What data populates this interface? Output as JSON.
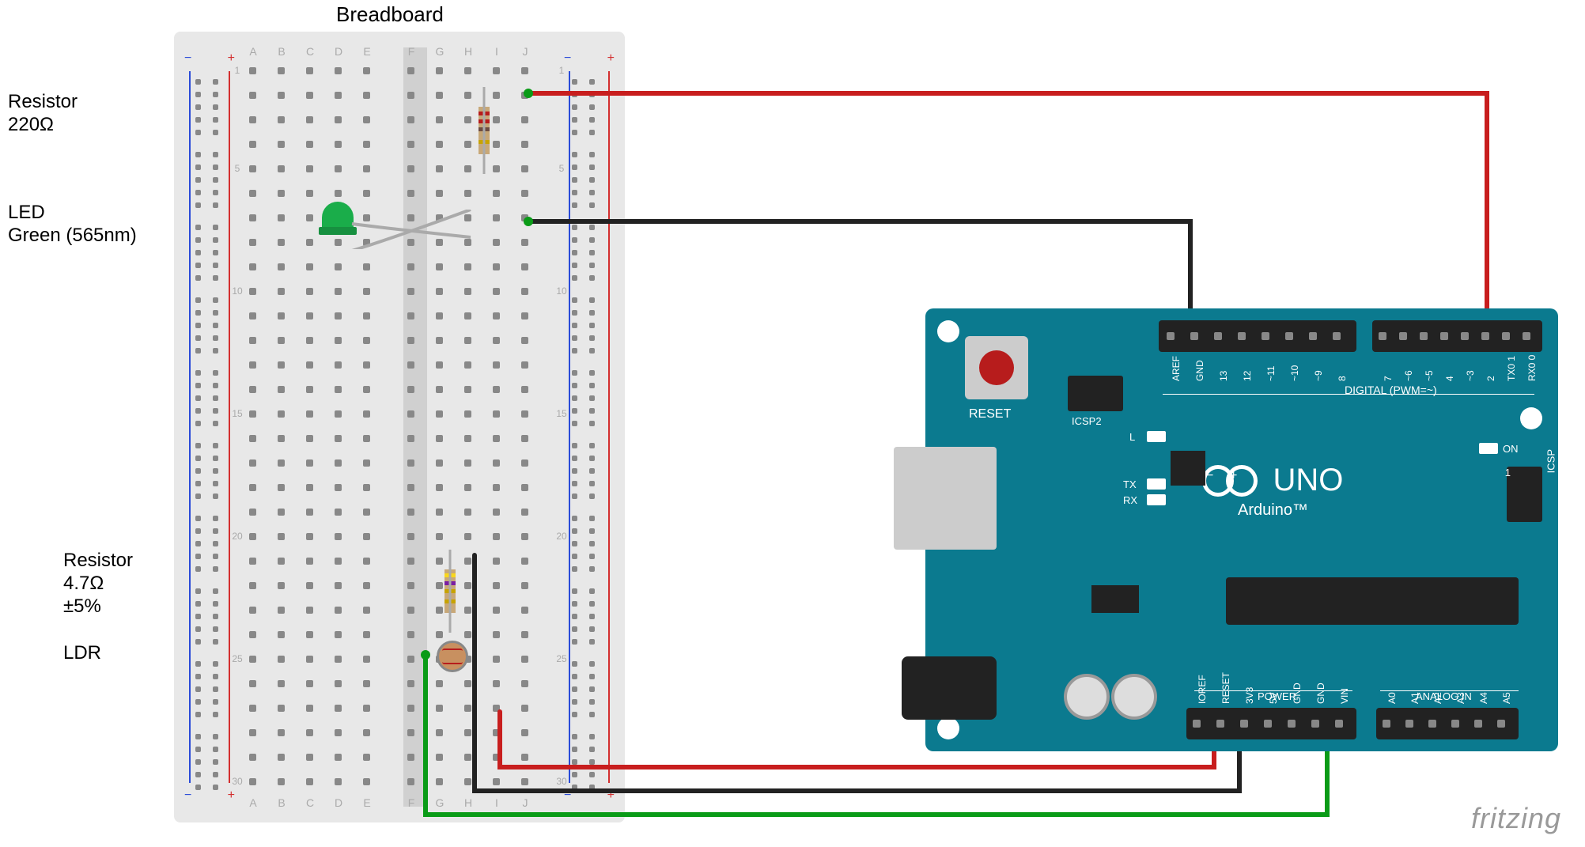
{
  "title": "Breadboard",
  "watermark": "fritzing",
  "labels": {
    "resistor1_name": "Resistor",
    "resistor1_val": "220Ω",
    "led_name": "LED",
    "led_val": "Green (565nm)",
    "resistor2_name": "Resistor",
    "resistor2_val": "4.7Ω",
    "resistor2_tol": "±5%",
    "ldr_name": "LDR"
  },
  "breadboard": {
    "cols_left": [
      "A",
      "B",
      "C",
      "D",
      "E"
    ],
    "cols_right": [
      "F",
      "G",
      "H",
      "I",
      "J"
    ],
    "visible_rows": [
      "1",
      "5",
      "10",
      "15",
      "20",
      "25",
      "30"
    ]
  },
  "arduino": {
    "name": "Arduino",
    "model": "UNO",
    "tm": "Arduino™",
    "reset": "RESET",
    "icsp2": "ICSP2",
    "icsp": "ICSP",
    "digital_label": "DIGITAL (PWM=~)",
    "power_label": "POWER",
    "analog_label": "ANALOG IN",
    "on": "ON",
    "L": "L",
    "TX": "TX",
    "RX": "RX",
    "one": "1",
    "digital_pins": [
      "AREF",
      "GND",
      "13",
      "12",
      "~11",
      "~10",
      "~9",
      "8",
      "",
      "7",
      "~6",
      "~5",
      "4",
      "~3",
      "2",
      "TX0 1",
      "RX0 0"
    ],
    "power_pins": [
      "IOREF",
      "RESET",
      "3V3",
      "5V",
      "GND",
      "GND",
      "VIN"
    ],
    "analog_pins": [
      "A0",
      "A1",
      "A2",
      "A3",
      "A4",
      "A5"
    ]
  },
  "components": [
    {
      "type": "resistor",
      "value": "220Ω",
      "bands": [
        "red",
        "red",
        "brown",
        "gold"
      ]
    },
    {
      "type": "resistor",
      "value": "4.7Ω",
      "bands": [
        "yellow",
        "violet",
        "gold",
        "gold"
      ]
    },
    {
      "type": "led",
      "color": "green",
      "wavelength_nm": 565
    },
    {
      "type": "ldr"
    }
  ],
  "connections": [
    {
      "from": "breadboard J3",
      "to": "arduino digital 2",
      "color": "red"
    },
    {
      "from": "breadboard J8",
      "to": "arduino GND (digital)",
      "color": "black"
    },
    {
      "from": "breadboard G21",
      "to": "arduino GND (power)",
      "color": "black"
    },
    {
      "from": "breadboard H28",
      "to": "arduino 5V",
      "color": "red"
    },
    {
      "from": "breadboard F25",
      "to": "arduino A0",
      "color": "green"
    }
  ]
}
